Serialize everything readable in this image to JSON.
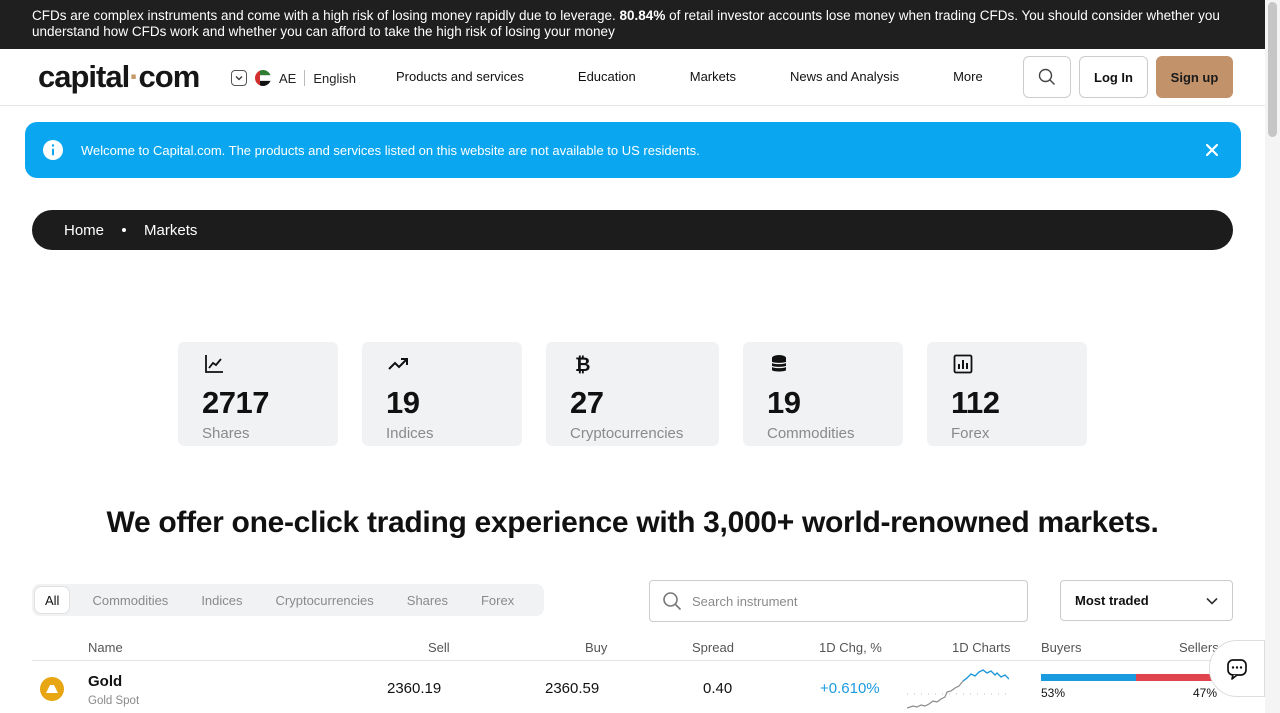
{
  "risk_banner": {
    "text_before": "CFDs are complex instruments and come with a high risk of losing money rapidly due to leverage. ",
    "percent": "80.84%",
    "text_after": " of retail investor accounts lose money when trading CFDs. You should consider whether you understand how CFDs work and whether you can afford to take the high risk of losing your money"
  },
  "header": {
    "logo_main": "capital",
    "logo_dot": "·",
    "logo_tld": "com",
    "region_code": "AE",
    "language": "English",
    "nav": [
      "Products and services",
      "Education",
      "Markets",
      "News and Analysis",
      "More"
    ],
    "login_label": "Log In",
    "signup_label": "Sign up"
  },
  "alert": {
    "message": "Welcome to Capital.com. The products and services listed on this website are not available to US residents."
  },
  "breadcrumb": {
    "home": "Home",
    "current": "Markets"
  },
  "stats": [
    {
      "icon": "line-chart-icon",
      "value": "2717",
      "label": "Shares"
    },
    {
      "icon": "trending-up-icon",
      "value": "19",
      "label": "Indices"
    },
    {
      "icon": "bitcoin-icon",
      "value": "27",
      "label": "Cryptocurrencies"
    },
    {
      "icon": "database-icon",
      "value": "19",
      "label": "Commodities"
    },
    {
      "icon": "bar-chart-icon",
      "value": "112",
      "label": "Forex"
    }
  ],
  "headline": "We offer one-click trading experience with 3,000+ world-renowned markets.",
  "filters": {
    "tabs": [
      "All",
      "Commodities",
      "Indices",
      "Cryptocurrencies",
      "Shares",
      "Forex"
    ],
    "active": "All",
    "search_placeholder": "Search instrument",
    "sort_label": "Most traded"
  },
  "table": {
    "headers": {
      "name": "Name",
      "sell": "Sell",
      "buy": "Buy",
      "spread": "Spread",
      "change": "1D Chg, %",
      "charts": "1D Charts",
      "buyers": "Buyers",
      "sellers": "Sellers"
    },
    "rows": [
      {
        "name": "Gold",
        "subtitle": "Gold Spot",
        "sell": "2360.19",
        "buy": "2360.59",
        "spread": "0.40",
        "change": "+0.610%",
        "buyers_pct": "53%",
        "sellers_pct": "47%",
        "buyers_share": 0.53
      }
    ]
  },
  "colors": {
    "brand_accent": "#c2926a",
    "alert_blue": "#0aa7f0",
    "positive": "#1a9be0",
    "negative": "#e0454e"
  }
}
